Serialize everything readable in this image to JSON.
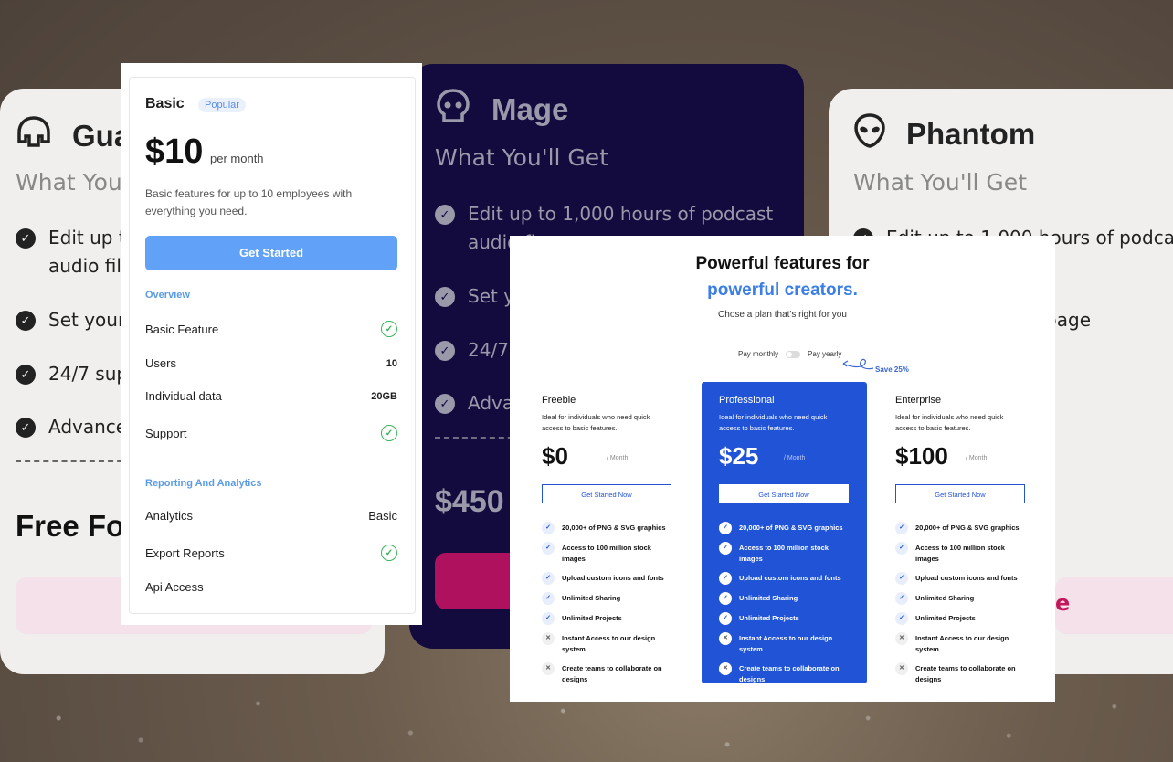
{
  "background_cards": {
    "guardian": {
      "title": "Gua",
      "sub": "What You'",
      "features": [
        "Edit up to",
        "audio file",
        "Set your",
        "24/7 sup",
        "Advanced"
      ],
      "free_label": "Free Fo"
    },
    "mage": {
      "title": "Mage",
      "sub": "What You'll Get",
      "features": [
        "Edit up to 1,000 hours of podcast",
        "audio fi",
        "Set yo",
        "24/7 s",
        "Adva"
      ],
      "price": "$450"
    },
    "phantom": {
      "title": "Phantom",
      "sub": "What You'll Get",
      "features": [
        "Edit up to 1,000 hours of podcast",
        "g page"
      ],
      "cta_fragment": "e"
    }
  },
  "basic": {
    "plan": "Basic",
    "badge": "Popular",
    "price": "$10",
    "per": "per month",
    "desc": "Basic features for up to 10 employees with everything you need.",
    "cta": "Get Started",
    "overview_label": "Overview",
    "overview": [
      {
        "label": "Basic Feature",
        "value": "check"
      },
      {
        "label": "Users",
        "value": "10"
      },
      {
        "label": "Individual data",
        "value": "20GB"
      },
      {
        "label": "Support",
        "value": "check"
      }
    ],
    "reporting_label": "Reporting And Analytics",
    "reporting": [
      {
        "label": "Analytics",
        "value": "Basic"
      },
      {
        "label": "Export Reports",
        "value": "check"
      },
      {
        "label": "Api Access",
        "value": "dash"
      }
    ]
  },
  "pricing": {
    "title_line1": "Powerful features for",
    "title_line2": "powerful creators.",
    "subtitle": "Chose a plan that's right for you",
    "toggle_monthly": "Pay monthly",
    "toggle_yearly": "Pay yearly",
    "save": "Save 25%",
    "accent": "#2153d6",
    "plans": [
      {
        "name": "Freebie",
        "desc": "Ideal for individuals who need quick access to basic features.",
        "price": "$0",
        "per": "/ Month",
        "cta": "Get Started Now"
      },
      {
        "name": "Professional",
        "desc": "Ideal for individuals who need quick access to basic features.",
        "price": "$25",
        "per": "/ Month",
        "cta": "Get Started Now"
      },
      {
        "name": "Enterprise",
        "desc": "Ideal for individuals who need quick access to basic features.",
        "price": "$100",
        "per": "/ Month",
        "cta": "Get Started Now"
      }
    ],
    "features": [
      "20,000+ of PNG & SVG graphics",
      "Access to 100 million stock images",
      "Upload custom icons and fonts",
      "Unlimited Sharing",
      "Unlimited Projects",
      "Instant Access to our design system",
      "Create teams to collaborate on designs"
    ],
    "included": [
      [
        true,
        true,
        true,
        true,
        true,
        false,
        false
      ],
      [
        true,
        true,
        true,
        true,
        true,
        false,
        false
      ],
      [
        true,
        true,
        true,
        true,
        true,
        false,
        false
      ]
    ]
  }
}
